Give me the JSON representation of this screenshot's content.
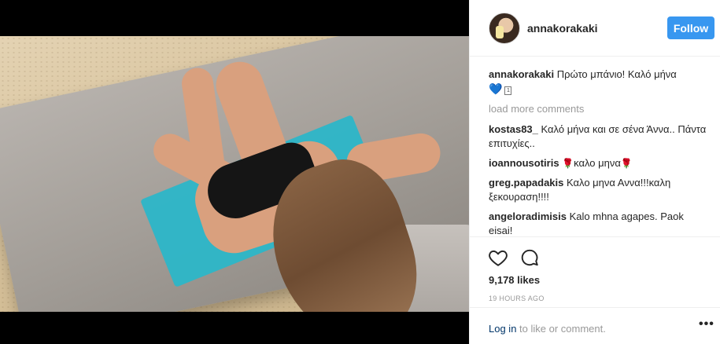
{
  "post": {
    "username": "annakorakaki",
    "follow_label": "Follow",
    "caption_user": "annakorakaki",
    "caption_text": "Πρώτο μπάνιο! Καλό μήνα",
    "caption_emoji": "💙",
    "caption_box": "1",
    "load_more": "load more comments",
    "comments": [
      {
        "user": "kostas83_",
        "text": "Καλό μήνα και σε σένα Άννα.. Πάντα επιτυχίες.."
      },
      {
        "user": "ioannousotiris",
        "text_before": "🌹",
        "text": "καλο μηνα",
        "text_after": "🌹"
      },
      {
        "user": "greg.papadakis",
        "text": "Καλο μηνα Αννα!!!καλη ξεκουραση!!!!"
      },
      {
        "user": "angeloradimisis",
        "text": "Kalo mhna agapes. Paok eisai!"
      }
    ],
    "likes": "9,178 likes",
    "time": "19 HOURS AGO",
    "login_link": "Log in",
    "login_rest": " to like or comment.",
    "more": "•••"
  },
  "colors": {
    "follow_bg": "#3897f0",
    "link": "#003569",
    "muted": "#999999"
  },
  "icons": [
    "heart-outline-icon",
    "comment-bubble-icon",
    "more-options-icon"
  ]
}
